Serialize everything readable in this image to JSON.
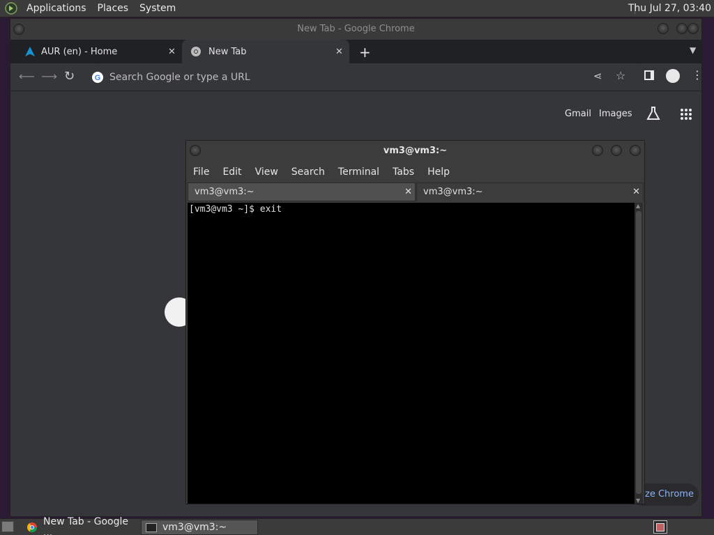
{
  "top_panel": {
    "menus": [
      "Applications",
      "Places",
      "System"
    ],
    "clock": "Thu Jul 27, 03:40"
  },
  "chrome": {
    "title": "New Tab - Google Chrome",
    "tabs": [
      {
        "label": "AUR (en) - Home",
        "icon": "arch-linux-icon"
      },
      {
        "label": "New Tab",
        "icon": "chrome-icon"
      }
    ],
    "omnibox_placeholder": "Search Google or type a URL",
    "ntp_links": [
      "Gmail",
      "Images"
    ],
    "customize_label": "ze Chrome"
  },
  "terminal": {
    "title": "vm3@vm3:~",
    "menus": [
      "File",
      "Edit",
      "View",
      "Search",
      "Terminal",
      "Tabs",
      "Help"
    ],
    "tabs": [
      "vm3@vm3:~",
      "vm3@vm3:~"
    ],
    "lines": [
      "[vm3@vm3 ~]$ exit"
    ]
  },
  "taskbar": {
    "items": [
      "New Tab - Google ...",
      "vm3@vm3:~"
    ]
  },
  "colors": {
    "desktop": "#2b1a33",
    "panel": "#3b3b3b",
    "chrome_bg": "#35363a",
    "terminal_bg": "#000000"
  }
}
